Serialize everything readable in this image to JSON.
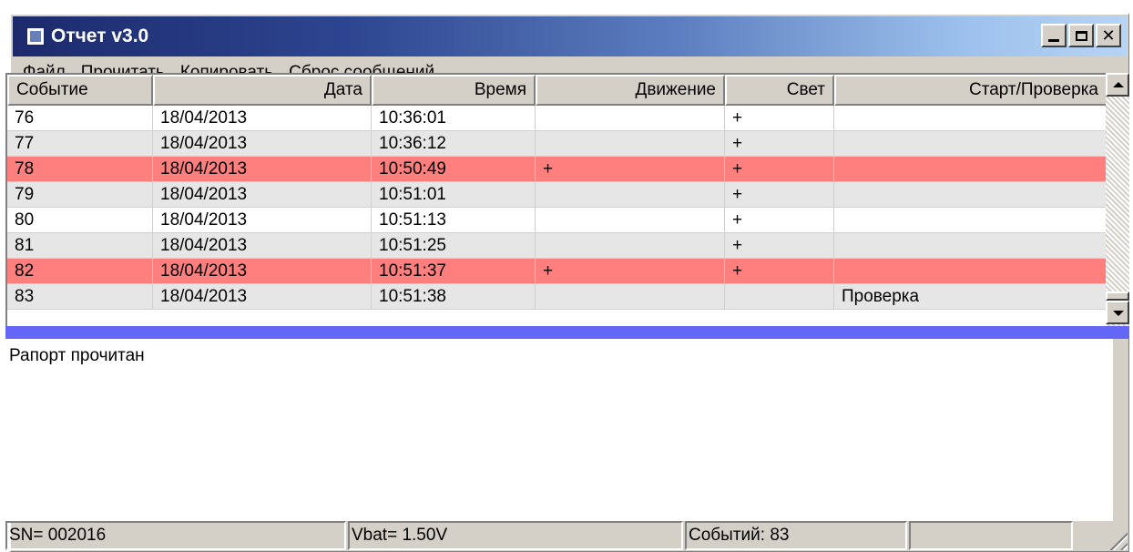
{
  "window": {
    "title": "Отчет v3.0"
  },
  "menu": [
    "Файл",
    "Прочитать",
    "Копировать",
    "Сброс сообщений"
  ],
  "table": {
    "columns": [
      "Событие",
      "Дата",
      "Время",
      "Движение",
      "Свет",
      "Старт/Проверка"
    ],
    "rows": [
      {
        "event": "76",
        "date": "18/04/2013",
        "time": "10:36:01",
        "motion": "",
        "light": "+",
        "start": "",
        "highlight": false
      },
      {
        "event": "77",
        "date": "18/04/2013",
        "time": "10:36:12",
        "motion": "",
        "light": "+",
        "start": "",
        "highlight": false
      },
      {
        "event": "78",
        "date": "18/04/2013",
        "time": "10:50:49",
        "motion": "+",
        "light": "+",
        "start": "",
        "highlight": true
      },
      {
        "event": "79",
        "date": "18/04/2013",
        "time": "10:51:01",
        "motion": "",
        "light": "+",
        "start": "",
        "highlight": false
      },
      {
        "event": "80",
        "date": "18/04/2013",
        "time": "10:51:13",
        "motion": "",
        "light": "+",
        "start": "",
        "highlight": false
      },
      {
        "event": "81",
        "date": "18/04/2013",
        "time": "10:51:25",
        "motion": "",
        "light": "+",
        "start": "",
        "highlight": false
      },
      {
        "event": "82",
        "date": "18/04/2013",
        "time": "10:51:37",
        "motion": "+",
        "light": "+",
        "start": "",
        "highlight": true
      },
      {
        "event": "83",
        "date": "18/04/2013",
        "time": "10:51:38",
        "motion": "",
        "light": "",
        "start": "Проверка",
        "highlight": false
      }
    ]
  },
  "log": {
    "message": "Рапорт прочитан"
  },
  "status": {
    "sn": "SN= 002016",
    "vbat": "Vbat= 1.50V",
    "events": "Событий: 83",
    "extra": ""
  },
  "colors": {
    "highlight_row": "#ff7f7f",
    "splitter": "#6466f6"
  }
}
